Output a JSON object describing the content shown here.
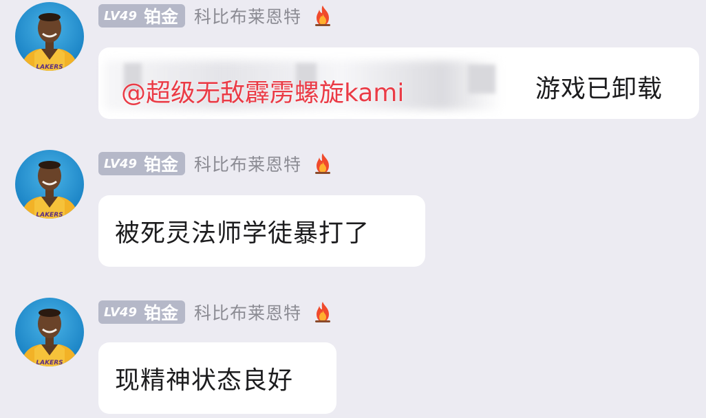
{
  "messages": [
    {
      "level": "LV49",
      "rank": "铂金",
      "username": "科比布莱恩特",
      "mention": "@超级无敌霹雳螺旋kami",
      "text": "游戏已卸载"
    },
    {
      "level": "LV49",
      "rank": "铂金",
      "username": "科比布莱恩特",
      "text": "被死灵法师学徒暴打了"
    },
    {
      "level": "LV49",
      "rank": "铂金",
      "username": "科比布莱恩特",
      "text": "现精神状态良好"
    }
  ],
  "avatar": {
    "jersey_text": "LAKERS",
    "jersey_color": "#f2b227",
    "background_color": "#1d86c7"
  },
  "colors": {
    "background": "#ecebf2",
    "bubble": "#ffffff",
    "badge": "#b5b8c8",
    "mention": "#ea3b46",
    "username": "#8b8b93"
  }
}
